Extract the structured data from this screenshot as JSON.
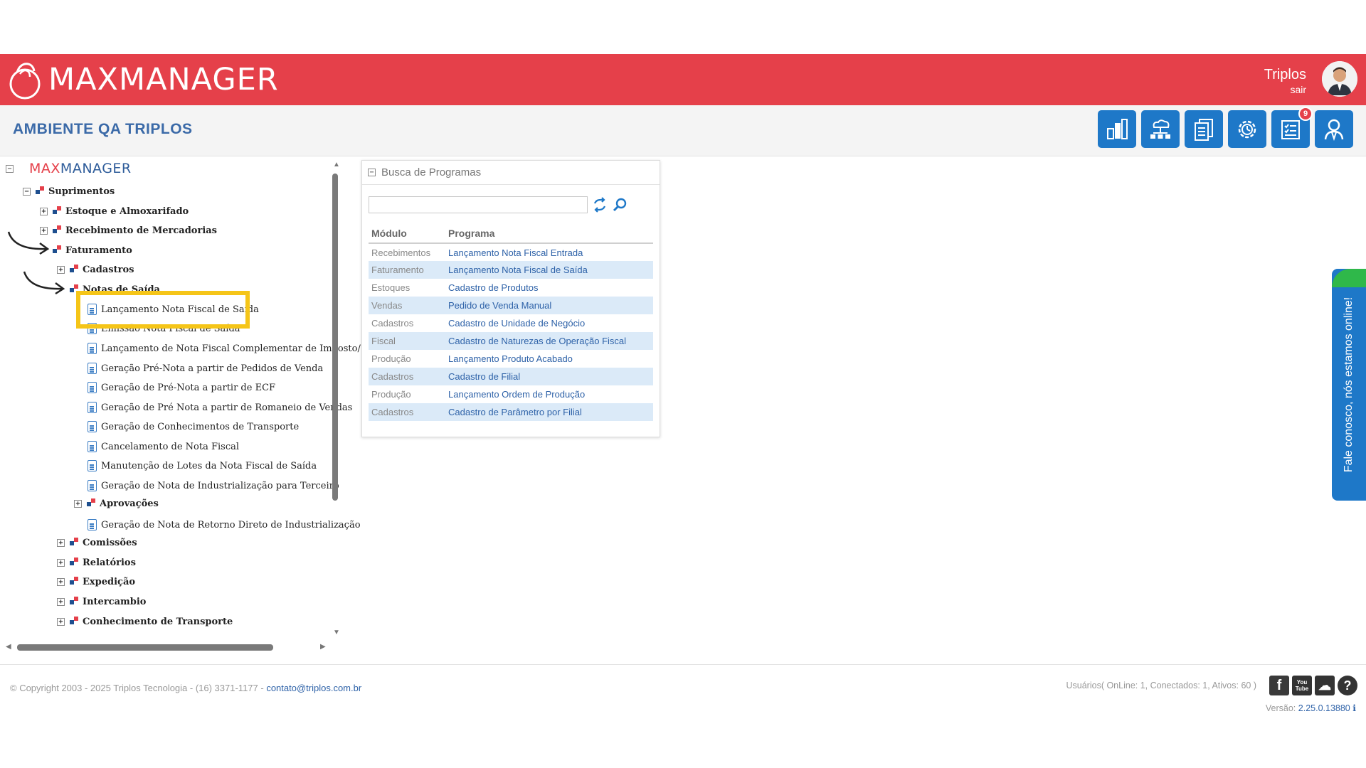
{
  "header": {
    "brand": "MAXMANAGER",
    "user_name": "Triplos",
    "logout": "sair",
    "environment": "AMBIENTE QA TRIPLOS",
    "notification_count": "9",
    "toolbar_icons": [
      "chart-icon",
      "network-icon",
      "documents-icon",
      "settings-icon",
      "tasks-icon",
      "user-admin-icon"
    ]
  },
  "tree": {
    "root_max": "MAX",
    "root_manager": "MANAGER",
    "suprimentos": "Suprimentos",
    "estoque": "Estoque e Almoxarifado",
    "recebimento": "Recebimento de Mercadorias",
    "faturamento": "Faturamento",
    "cadastros": "Cadastros",
    "notas_saida": "Notas de Saída",
    "items": [
      "Lançamento Nota Fiscal de Saída",
      "Emissão Nota Fiscal de Saída",
      "Lançamento de Nota Fiscal Complementar de Imposto/",
      "Geração Pré-Nota a partir de Pedidos de Venda",
      "Geração de Pré-Nota a partir de ECF",
      "Geração de Pré Nota a partir de Romaneio de Vendas",
      "Geração de Conhecimentos de Transporte",
      "Cancelamento de Nota Fiscal",
      "Manutenção de Lotes da Nota Fiscal de Saída",
      "Geração de Nota de Industrialização para Terceiro"
    ],
    "aprovacoes": "Aprovações",
    "retorno": "Geração de Nota de Retorno Direto de Industrialização",
    "comissoes": "Comissões",
    "relatorios": "Relatórios",
    "expedicao": "Expedição",
    "intercambio": "Intercambio",
    "conhecimento": "Conhecimento de Transporte"
  },
  "search_panel": {
    "title": "Busca de Programas",
    "search_value": "",
    "columns": [
      "Módulo",
      "Programa"
    ],
    "rows": [
      [
        "Recebimentos",
        "Lançamento Nota Fiscal Entrada"
      ],
      [
        "Faturamento",
        "Lançamento Nota Fiscal de Saída"
      ],
      [
        "Estoques",
        "Cadastro de Produtos"
      ],
      [
        "Vendas",
        "Pedido de Venda Manual"
      ],
      [
        "Cadastros",
        "Cadastro de Unidade de Negócio"
      ],
      [
        "Fiscal",
        "Cadastro de Naturezas de Operação Fiscal"
      ],
      [
        "Produção",
        "Lançamento Produto Acabado"
      ],
      [
        "Cadastros",
        "Cadastro de Filial"
      ],
      [
        "Produção",
        "Lançamento Ordem de Produção"
      ],
      [
        "Cadastros",
        "Cadastro de Parâmetro por Filial"
      ]
    ]
  },
  "chat": {
    "label": "Fale conosco, nós estamos online!"
  },
  "footer": {
    "copyright": "© Copyright 2003 - 2025 Triplos Tecnologia - (16) 3371-1177 - ",
    "email": "contato@triplos.com.br",
    "users": "Usuários( OnLine: 1, Conectados: 1, Ativos: 60 )",
    "version_label": "Versão: ",
    "version_number": "2.25.0.13880",
    "social": [
      "f",
      "You Tube",
      "☁",
      "?"
    ]
  },
  "colors": {
    "brand_red": "#e5404a",
    "brand_blue": "#1e78c8",
    "highlight": "#f5c518"
  }
}
